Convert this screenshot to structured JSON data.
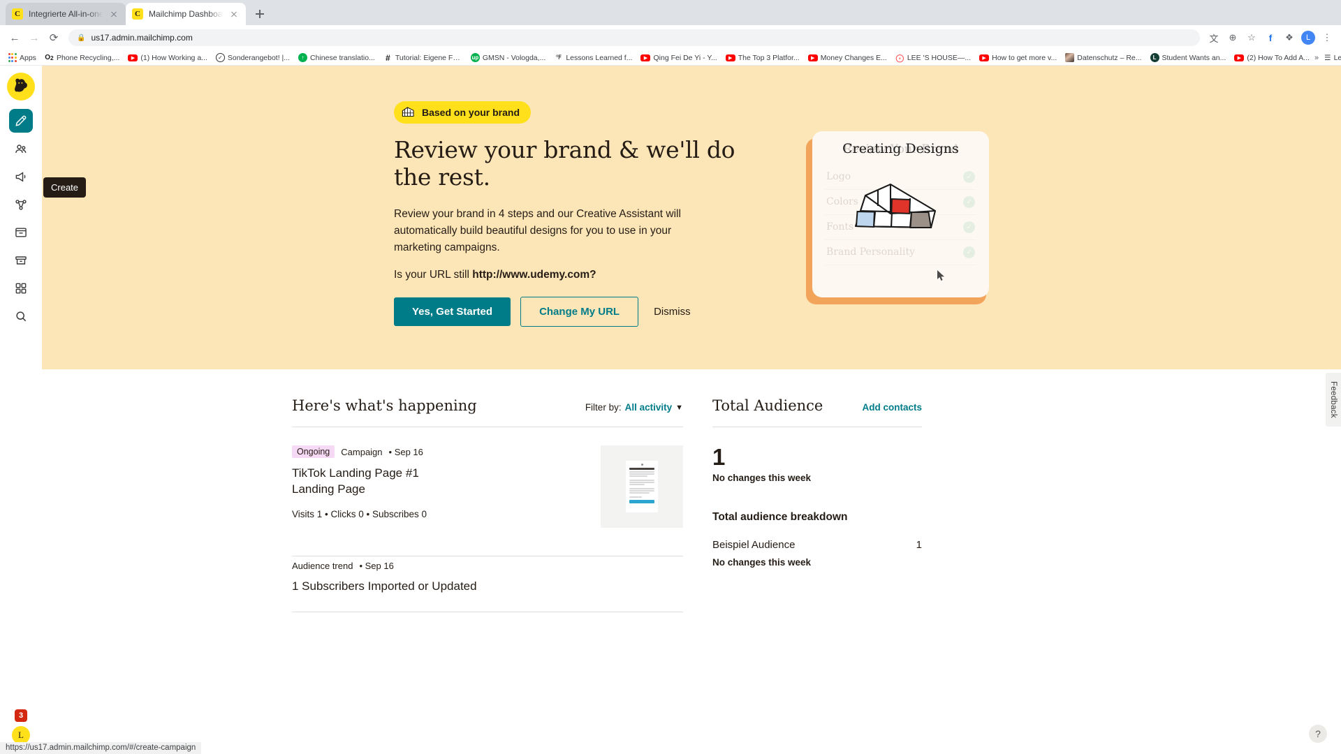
{
  "browser": {
    "tabs": [
      {
        "title": "Integrierte All-in-one-Marketing",
        "favicon": "mailchimp-favicon",
        "active": false
      },
      {
        "title": "Mailchimp Dashboard | Mailchi",
        "favicon": "mailchimp-favicon",
        "active": true
      }
    ],
    "new_tab_label": "+",
    "nav": {
      "back": "←",
      "forward": "→",
      "reload": "⟳"
    },
    "address": {
      "url": "us17.admin.mailchimp.com",
      "lock_icon": "lock-icon"
    },
    "toolbar_right": [
      {
        "name": "translate-icon",
        "glyph": "文"
      },
      {
        "name": "zoom-icon",
        "glyph": "⊕"
      },
      {
        "name": "bookmark-star-icon",
        "glyph": "☆"
      },
      {
        "name": "facebook-extension-icon",
        "glyph": "f"
      },
      {
        "name": "puzzle-extension-icon",
        "glyph": "❖"
      },
      {
        "name": "profile-avatar",
        "glyph": "L"
      },
      {
        "name": "chrome-menu-icon",
        "glyph": "⋮"
      }
    ],
    "bookmarks": [
      {
        "label": "Apps",
        "icon": "apps-grid-icon"
      },
      {
        "label": "Phone Recycling,...",
        "icon": "o2-icon"
      },
      {
        "label": "(1) How Working a...",
        "icon": "youtube-icon"
      },
      {
        "label": "Sonderangebot! |...",
        "icon": "circle-check-icon"
      },
      {
        "label": "Chinese translatio...",
        "icon": "green-circle-icon"
      },
      {
        "label": "Tutorial: Eigene Fa...",
        "icon": "hash-icon"
      },
      {
        "label": "GMSN - Vologda,...",
        "icon": "green-up-icon"
      },
      {
        "label": "Lessons Learned f...",
        "icon": "degree-f-icon"
      },
      {
        "label": "Qing Fei De Yi - Y...",
        "icon": "youtube-icon"
      },
      {
        "label": "The Top 3 Platfor...",
        "icon": "youtube-icon"
      },
      {
        "label": "Money Changes E...",
        "icon": "youtube-icon"
      },
      {
        "label": "LEE 'S HOUSE—...",
        "icon": "airbnb-icon"
      },
      {
        "label": "How to get more v...",
        "icon": "youtube-icon"
      },
      {
        "label": "Datenschutz – Re...",
        "icon": "photo-icon"
      },
      {
        "label": "Student Wants an...",
        "icon": "green-circle-icon"
      },
      {
        "label": "(2) How To Add A...",
        "icon": "youtube-icon"
      }
    ],
    "overflow_label": "»",
    "reading_list": {
      "label": "Leseliste",
      "icon": "reading-list-icon"
    },
    "status_url": "https://us17.admin.mailchimp.com/#/create-campaign"
  },
  "rail": {
    "logo_name": "mailchimp-freddie-logo",
    "items": [
      {
        "name": "create-button",
        "icon": "pencil-icon",
        "active": true
      },
      {
        "name": "audience-button",
        "icon": "people-icon",
        "active": false
      },
      {
        "name": "campaigns-button",
        "icon": "megaphone-icon",
        "active": false
      },
      {
        "name": "automations-button",
        "icon": "automation-icon",
        "active": false
      },
      {
        "name": "website-button",
        "icon": "browser-window-icon",
        "active": false
      },
      {
        "name": "content-button",
        "icon": "archive-icon",
        "active": false
      },
      {
        "name": "integrations-button",
        "icon": "grid-icon",
        "active": false
      },
      {
        "name": "search-button",
        "icon": "search-icon",
        "active": false
      }
    ],
    "tooltip": "Create",
    "notification_count": "3",
    "user_initial": "L"
  },
  "hero": {
    "pill": {
      "label": "Based on your brand",
      "icon": "greenhouse-icon"
    },
    "headline": "Review your brand & we'll do the rest.",
    "body": "Review your brand in 4 steps and our Creative Assistant will automatically build beautiful designs for you to use in your marketing campaigns.",
    "url_prefix": "Is your URL still ",
    "url": "http://www.udemy.com?",
    "primary_button": "Yes, Get Started",
    "secondary_button": "Change My URL",
    "dismiss_button": "Dismiss",
    "card": {
      "front_title": "Creating Designs",
      "ghost_title": "Review Your Brand",
      "ghost_rows": [
        {
          "label": "Logo",
          "state": "checked"
        },
        {
          "label": "Colors",
          "state": "checked"
        },
        {
          "label": "Fonts",
          "state": "checked"
        },
        {
          "label": "Brand Personality",
          "state": "checked"
        }
      ],
      "illustration": "greenhouse-illustration",
      "cursor": "cursor-arrow"
    }
  },
  "activity": {
    "title": "Here's what's happening",
    "filter_label": "Filter by:",
    "filter_value": "All activity",
    "items": [
      {
        "tag": "Ongoing",
        "type": "Campaign",
        "date": "• Sep 16",
        "title_line1": "TikTok Landing Page #1",
        "title_line2": "Landing Page",
        "stats": "Visits 1 • Clicks 0 • Subscribes 0",
        "thumbnail": "landing-page-thumbnail"
      },
      {
        "tag": "",
        "type": "Audience trend",
        "date": "• Sep 16",
        "title_line1": "1 Subscribers Imported or Updated",
        "title_line2": "",
        "stats": "",
        "thumbnail": ""
      }
    ]
  },
  "audience": {
    "title": "Total Audience",
    "add_link": "Add contacts",
    "total": "1",
    "change_note": "No changes this week",
    "breakdown_title": "Total audience breakdown",
    "rows": [
      {
        "name": "Beispiel Audience",
        "count": "1",
        "note": "No changes this week"
      }
    ]
  },
  "misc": {
    "feedback_label": "Feedback",
    "help_label": "?"
  },
  "colors": {
    "accent": "#007c89",
    "brand_yellow": "#ffe01b",
    "hero_bg": "#fce5b6",
    "tag_pink": "#f6d9f4",
    "badge_red": "#d3280f"
  }
}
